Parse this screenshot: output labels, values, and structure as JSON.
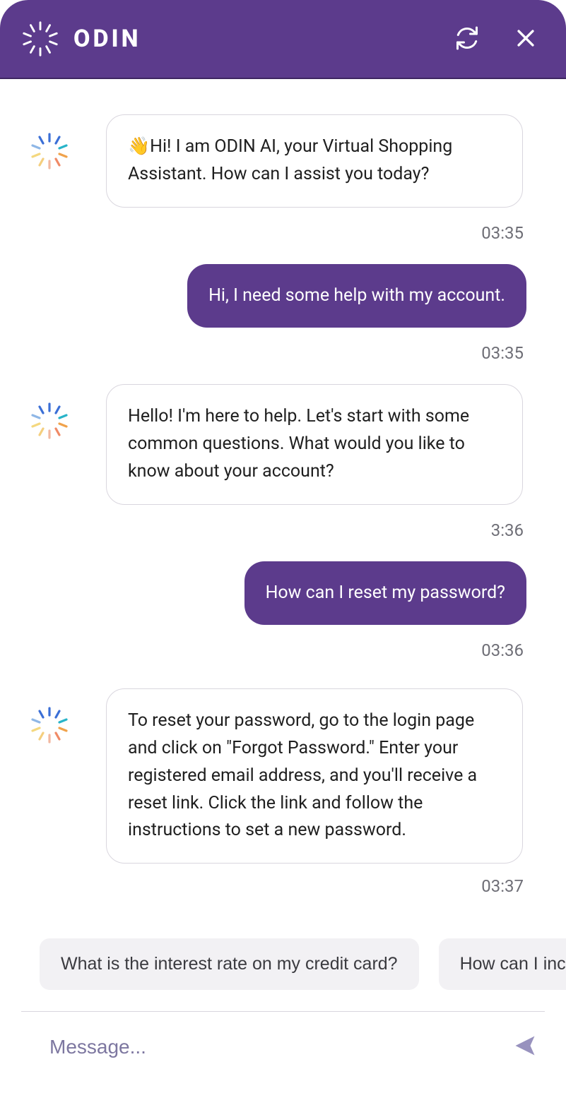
{
  "header": {
    "brand": "ODIN"
  },
  "icons": {
    "refresh": "refresh-icon",
    "close": "close-icon",
    "send": "send-icon",
    "logo": "odin-logo-icon",
    "wave": "👋"
  },
  "messages": [
    {
      "role": "bot",
      "emoji": "👋",
      "text": "Hi! I am ODIN AI, your Virtual Shopping Assistant. How can I assist you today?",
      "time": "03:35"
    },
    {
      "role": "user",
      "text": "Hi, I need some help with my account.",
      "time": "03:35"
    },
    {
      "role": "bot",
      "text": "Hello! I'm here to help. Let's start with some common questions. What would you like to know about your account?",
      "time": "3:36"
    },
    {
      "role": "user",
      "text": "How can I reset my password?",
      "time": "03:36"
    },
    {
      "role": "bot",
      "text": "To reset your password, go to the login page and click on \"Forgot Password.\" Enter your registered email address, and you'll receive a reset link. Click the link and follow the instructions to set a new password.",
      "time": "03:37"
    }
  ],
  "suggestions": [
    "What is the interest rate on my credit card?",
    "How can I increase my credit limit?"
  ],
  "composer": {
    "placeholder": "Message...",
    "value": ""
  }
}
